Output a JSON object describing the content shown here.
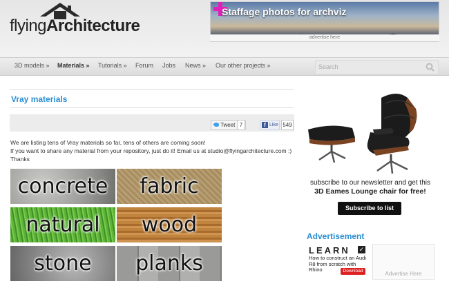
{
  "header": {
    "logo": {
      "part1": "flying",
      "part2": "Architecture"
    },
    "banner": {
      "text": "Staffage photos for archviz",
      "caption": "advertise here"
    }
  },
  "nav": {
    "items": [
      {
        "label": "3D models »"
      },
      {
        "label": "Materials »"
      },
      {
        "label": "Tutorials »"
      },
      {
        "label": "Forum"
      },
      {
        "label": "Jobs"
      },
      {
        "label": "News »"
      },
      {
        "label": "Our other projects »"
      }
    ],
    "active_index": 1,
    "search_placeholder": "Search"
  },
  "main": {
    "title": "Vray materials",
    "share": {
      "tweet_label": "Tweet",
      "tweet_count": "7",
      "like_label": "Like",
      "like_count": "549"
    },
    "intro": [
      "We are listing tens of Vray materials so far, tens of others are coming soon!",
      "If you want to share any material from your repository, just do it! Email us at studio@flyingarchitecture.com :)",
      "Thanks"
    ],
    "categories": [
      "concrete",
      "fabric",
      "natural",
      "wood",
      "stone",
      "planks"
    ]
  },
  "sidebar": {
    "newsletter_line1": "subscribe to our newsletter and get this",
    "newsletter_line2": "3D Eames Lounge chair for free!",
    "subscribe_button": "Subscribe to list",
    "advertisement_title": "Advertisement",
    "ad1": {
      "brand": "LEARN",
      "description": "How to construct an Audi R8 from scratch with Rhino",
      "button": "Download"
    },
    "ad2": {
      "text": "Advertise Here"
    }
  },
  "colors": {
    "accent": "#2a8ed3",
    "banner_plus": "#e21fb8"
  }
}
